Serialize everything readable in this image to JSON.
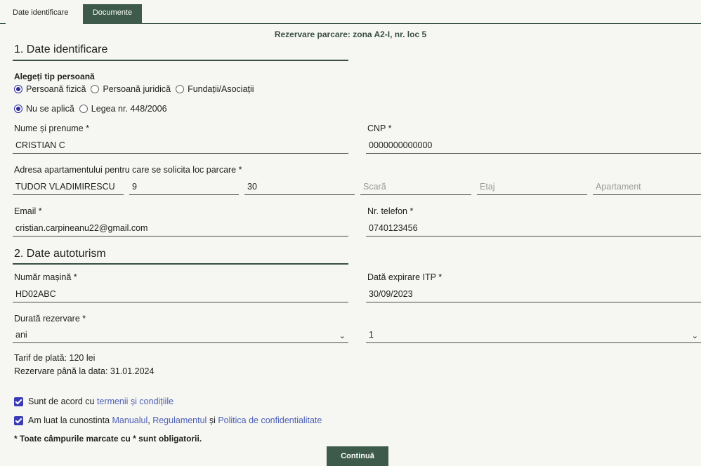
{
  "tabs": {
    "tab1": "Date identificare",
    "tab2": "Documente"
  },
  "subtitle": "Rezervare parcare: zona A2-I, nr. loc 5",
  "section1": {
    "title": "1. Date identificare",
    "person_type_label": "Alegeți tip persoană",
    "person_types": [
      "Persoană fizică",
      "Persoană juridică",
      "Fundații/Asociații"
    ],
    "law_options": [
      "Nu se aplică",
      "Legea nr. 448/2006"
    ],
    "name_label": "Nume și prenume *",
    "name_value": "CRISTIAN C",
    "cnp_label": "CNP *",
    "cnp_value": "0000000000000",
    "address_label": "Adresa apartamentului pentru care se solicita loc parcare *",
    "street_value": "TUDOR VLADIMIRESCU",
    "number_value": "9",
    "block_value": "30",
    "scara_placeholder": "Scară",
    "etaj_placeholder": "Etaj",
    "apartament_placeholder": "Apartament",
    "email_label": "Email *",
    "email_value": "cristian.carpineanu22@gmail.com",
    "phone_label": "Nr. telefon *",
    "phone_value": "0740123456"
  },
  "section2": {
    "title": "2. Date autoturism",
    "car_label": "Număr mașină *",
    "car_value": "HD02ABC",
    "itp_label": "Dată expirare ITP *",
    "itp_value": "30/09/2023",
    "duration_label": "Durată rezervare *",
    "duration_unit": "ani",
    "duration_count": "1",
    "tariff": "Tarif de plată: 120 lei",
    "until": "Rezervare până la data: 31.01.2024"
  },
  "consents": {
    "c1_prefix": "Sunt de acord cu ",
    "c1_link": "termenii și condițiile",
    "c2_prefix": "Am luat la cunostinta ",
    "c2_link1": "Manualul",
    "c2_sep": ", ",
    "c2_link2": "Regulamentul",
    "c2_and": " și ",
    "c2_link3": "Politica de confidentialitate"
  },
  "required_note": "* Toate câmpurile marcate cu * sunt obligatorii.",
  "continue_label": "Continuă"
}
